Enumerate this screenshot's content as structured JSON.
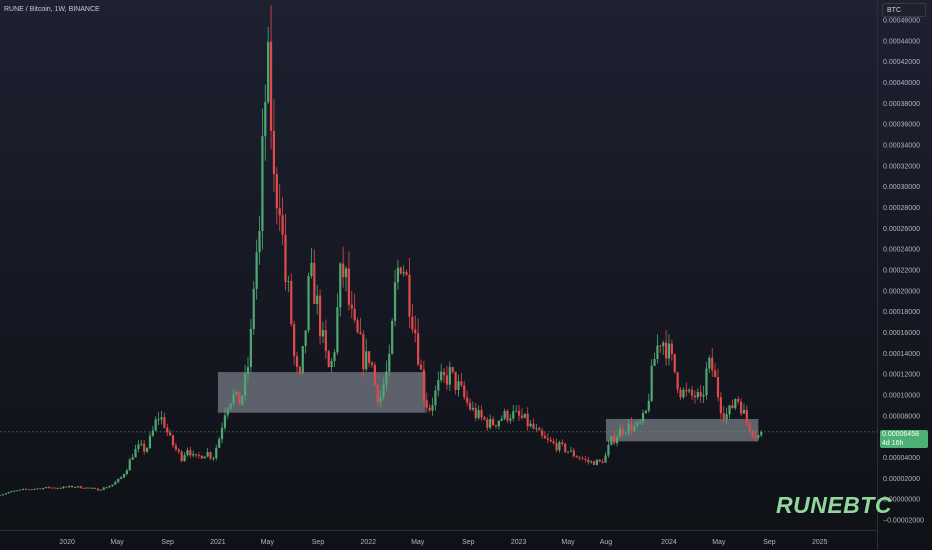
{
  "legend": {
    "symbol": "RUNE / Bitcoin, 1W, BINANCE"
  },
  "currency_label": "BTC",
  "watermark": "RUNEBTC",
  "last_price": {
    "value": "0.00006458",
    "countdown": "4d 16h",
    "raw": 6.458e-05
  },
  "colors": {
    "up": "#4fa872",
    "down": "#e14a4a",
    "zone": "#9aa0ac",
    "bg": "#131722"
  },
  "chart_data": {
    "type": "candlestick",
    "x_time_range": [
      "2019-07-22",
      "2025-05-20"
    ],
    "ylim": [
      -2e-05,
      0.00046
    ],
    "y_ticks": [
      -2e-05,
      0.0,
      2e-05,
      4e-05,
      6e-05,
      8e-05,
      0.0001,
      0.00012,
      0.00014,
      0.00016,
      0.00018,
      0.0002,
      0.00022,
      0.00024,
      0.00026,
      0.00028,
      0.0003,
      0.00032,
      0.00034,
      0.00036,
      0.00038,
      0.0004,
      0.00042,
      0.00044,
      0.00046
    ],
    "y_tick_labels": [
      "−0.00002000",
      "0.00000000",
      "0.00002000",
      "0.00004000",
      "0.00006000",
      "0.00008000",
      "0.00010000",
      "0.00012000",
      "0.00014000",
      "0.00016000",
      "0.00018000",
      "0.00020000",
      "0.00022000",
      "0.00024000",
      "0.00026000",
      "0.00028000",
      "0.00030000",
      "0.00032000",
      "0.00034000",
      "0.00036000",
      "0.00038000",
      "0.00040000",
      "0.00042000",
      "0.00044000",
      "0.00046000"
    ],
    "x_ticks": [
      {
        "label": "2020",
        "date": "2020-01-01"
      },
      {
        "label": "May",
        "date": "2020-05-01"
      },
      {
        "label": "Sep",
        "date": "2020-09-01"
      },
      {
        "label": "2021",
        "date": "2021-01-01"
      },
      {
        "label": "May",
        "date": "2021-05-01"
      },
      {
        "label": "Sep",
        "date": "2021-09-01"
      },
      {
        "label": "2022",
        "date": "2022-01-01"
      },
      {
        "label": "May",
        "date": "2022-05-01"
      },
      {
        "label": "Sep",
        "date": "2022-09-01"
      },
      {
        "label": "2023",
        "date": "2023-01-01"
      },
      {
        "label": "May",
        "date": "2023-05-01"
      },
      {
        "label": "Aug",
        "date": "2023-08-01"
      },
      {
        "label": "2024",
        "date": "2024-01-01"
      },
      {
        "label": "May",
        "date": "2024-05-01"
      },
      {
        "label": "Sep",
        "date": "2024-09-01"
      },
      {
        "label": "2025",
        "date": "2025-01-01"
      }
    ],
    "zones": [
      {
        "from": "2021-01-01",
        "to": "2022-05-20",
        "low": 8.3e-05,
        "high": 0.000122
      },
      {
        "from": "2023-08-01",
        "to": "2024-08-05",
        "low": 5.55e-05,
        "high": 7.7e-05
      }
    ],
    "price_line": 6.458e-05,
    "series": [
      {
        "values": [
          [
            "2019-07-22",
            4e-06
          ],
          [
            "2019-08-15",
            7e-06
          ],
          [
            "2019-09-15",
            9e-06
          ],
          [
            "2019-10-15",
            1e-05
          ],
          [
            "2019-11-15",
            1.1e-05
          ],
          [
            "2019-12-15",
            1.1e-05
          ],
          [
            "2020-01-15",
            1.2e-05
          ],
          [
            "2020-02-15",
            1.1e-05
          ],
          [
            "2020-03-15",
            9e-06
          ],
          [
            "2020-04-01",
            1.1e-05
          ],
          [
            "2020-04-20",
            1.4e-05
          ],
          [
            "2020-05-10",
            2e-05
          ],
          [
            "2020-05-25",
            3e-05
          ],
          [
            "2020-06-10",
            4.5e-05
          ],
          [
            "2020-06-25",
            5e-05
          ],
          [
            "2020-07-10",
            4.7e-05
          ],
          [
            "2020-07-25",
            6.2e-05
          ],
          [
            "2020-08-08",
            8e-05
          ],
          [
            "2020-08-22",
            7.5e-05
          ],
          [
            "2020-09-05",
            5.8e-05
          ],
          [
            "2020-09-20",
            4.8e-05
          ],
          [
            "2020-10-05",
            4e-05
          ],
          [
            "2020-10-20",
            5e-05
          ],
          [
            "2020-11-05",
            3.8e-05
          ],
          [
            "2020-11-20",
            4.2e-05
          ],
          [
            "2020-12-05",
            4.5e-05
          ],
          [
            "2020-12-20",
            4e-05
          ],
          [
            "2021-01-05",
            6e-05
          ],
          [
            "2021-01-20",
            9e-05
          ],
          [
            "2021-02-05",
            0.0001
          ],
          [
            "2021-02-20",
            9.2e-05
          ],
          [
            "2021-03-05",
            0.000105
          ],
          [
            "2021-03-20",
            0.00014
          ],
          [
            "2021-04-01",
            0.00023
          ],
          [
            "2021-04-12",
            0.00025
          ],
          [
            "2021-04-24",
            0.00038
          ],
          [
            "2021-05-05",
            0.00041
          ],
          [
            "2021-05-18",
            0.00029
          ],
          [
            "2021-05-30",
            0.0003
          ],
          [
            "2021-06-12",
            0.000215
          ],
          [
            "2021-06-24",
            0.00019
          ],
          [
            "2021-07-06",
            0.00013
          ],
          [
            "2021-07-18",
            0.00011
          ],
          [
            "2021-07-30",
            0.00015
          ],
          [
            "2021-08-12",
            0.000215
          ],
          [
            "2021-08-24",
            0.0002
          ],
          [
            "2021-09-05",
            0.00017
          ],
          [
            "2021-09-17",
            0.00014
          ],
          [
            "2021-09-30",
            0.00012
          ],
          [
            "2021-10-12",
            0.00015
          ],
          [
            "2021-10-24",
            0.00021
          ],
          [
            "2021-11-05",
            0.00022
          ],
          [
            "2021-11-17",
            0.00018
          ],
          [
            "2021-11-29",
            0.00016
          ],
          [
            "2021-12-11",
            0.00015
          ],
          [
            "2021-12-23",
            0.00013
          ],
          [
            "2022-01-05",
            0.00014
          ],
          [
            "2022-01-17",
            0.00011
          ],
          [
            "2022-01-29",
            9.5e-05
          ],
          [
            "2022-02-10",
            0.000115
          ],
          [
            "2022-02-22",
            0.00013
          ],
          [
            "2022-03-07",
            0.0002
          ],
          [
            "2022-03-19",
            0.000235
          ],
          [
            "2022-03-31",
            0.00022
          ],
          [
            "2022-04-12",
            0.00019
          ],
          [
            "2022-04-24",
            0.000165
          ],
          [
            "2022-05-06",
            0.00013
          ],
          [
            "2022-05-18",
            9.5e-05
          ],
          [
            "2022-05-30",
            8.8e-05
          ],
          [
            "2022-06-12",
            0.0001
          ],
          [
            "2022-06-24",
            0.000112
          ],
          [
            "2022-07-06",
            0.000115
          ],
          [
            "2022-07-18",
            0.00012
          ],
          [
            "2022-07-30",
            0.000112
          ],
          [
            "2022-08-12",
            0.000105
          ],
          [
            "2022-08-24",
            9.5e-05
          ],
          [
            "2022-09-05",
            8.8e-05
          ],
          [
            "2022-09-17",
            8.2e-05
          ],
          [
            "2022-09-30",
            7.8e-05
          ],
          [
            "2022-10-12",
            7.5e-05
          ],
          [
            "2022-10-24",
            7.2e-05
          ],
          [
            "2022-11-05",
            7.4e-05
          ],
          [
            "2022-11-17",
            7.8e-05
          ],
          [
            "2022-11-29",
            8e-05
          ],
          [
            "2022-12-11",
            8.2e-05
          ],
          [
            "2022-12-23",
            8e-05
          ],
          [
            "2023-01-05",
            7.8e-05
          ],
          [
            "2023-01-17",
            7.5e-05
          ],
          [
            "2023-01-29",
            7e-05
          ],
          [
            "2023-02-10",
            6.6e-05
          ],
          [
            "2023-02-22",
            6e-05
          ],
          [
            "2023-03-07",
            5.6e-05
          ],
          [
            "2023-03-19",
            5.4e-05
          ],
          [
            "2023-03-31",
            5.2e-05
          ],
          [
            "2023-04-12",
            5e-05
          ],
          [
            "2023-04-24",
            4.8e-05
          ],
          [
            "2023-05-06",
            4.5e-05
          ],
          [
            "2023-05-18",
            4.2e-05
          ],
          [
            "2023-05-30",
            4e-05
          ],
          [
            "2023-06-12",
            3.7e-05
          ],
          [
            "2023-06-24",
            3.5e-05
          ],
          [
            "2023-07-06",
            3.6e-05
          ],
          [
            "2023-07-18",
            3.5e-05
          ],
          [
            "2023-07-30",
            4e-05
          ],
          [
            "2023-08-12",
            5.5e-05
          ],
          [
            "2023-08-24",
            6e-05
          ],
          [
            "2023-09-05",
            6.6e-05
          ],
          [
            "2023-09-17",
            6.8e-05
          ],
          [
            "2023-09-30",
            7e-05
          ],
          [
            "2023-10-12",
            6.8e-05
          ],
          [
            "2023-10-24",
            7.2e-05
          ],
          [
            "2023-11-05",
            8e-05
          ],
          [
            "2023-11-17",
            0.00011
          ],
          [
            "2023-11-29",
            0.00014
          ],
          [
            "2023-12-11",
            0.000155
          ],
          [
            "2023-12-23",
            0.00015
          ],
          [
            "2024-01-05",
            0.000135
          ],
          [
            "2024-01-17",
            0.00012
          ],
          [
            "2024-01-29",
            0.000105
          ],
          [
            "2024-02-10",
            0.0001
          ],
          [
            "2024-02-22",
            9.8e-05
          ],
          [
            "2024-03-07",
            0.0001
          ],
          [
            "2024-03-19",
            9e-05
          ],
          [
            "2024-03-31",
            0.00012
          ],
          [
            "2024-04-12",
            0.00013
          ],
          [
            "2024-04-24",
            0.00011
          ],
          [
            "2024-05-06",
            9e-05
          ],
          [
            "2024-05-18",
            8e-05
          ],
          [
            "2024-05-30",
            8.5e-05
          ],
          [
            "2024-06-12",
            0.0001
          ],
          [
            "2024-06-24",
            9e-05
          ],
          [
            "2024-07-06",
            7.5e-05
          ],
          [
            "2024-07-18",
            6.8e-05
          ],
          [
            "2024-07-30",
            6.2e-05
          ],
          [
            "2024-08-08",
            6e-05
          ],
          [
            "2024-08-15",
            6.4e-05
          ]
        ]
      }
    ]
  }
}
